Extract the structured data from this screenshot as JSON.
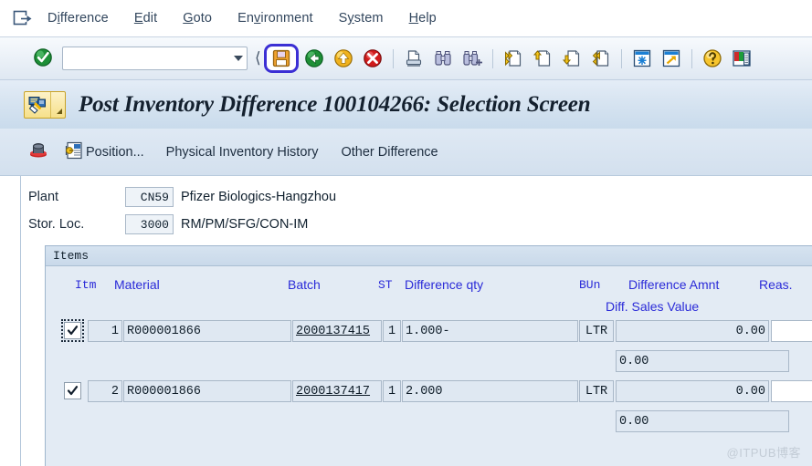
{
  "menubar": {
    "system_icon": "sap-system-menu-icon",
    "items": [
      {
        "label": "Difference",
        "accel_index": 1
      },
      {
        "label": "Edit",
        "accel_index": 0
      },
      {
        "label": "Goto",
        "accel_index": 0
      },
      {
        "label": "Environment",
        "accel_index": 2
      },
      {
        "label": "System",
        "accel_index": 1
      },
      {
        "label": "Help",
        "accel_index": 0
      }
    ]
  },
  "toolbar": {
    "ok_icon": "green-check-icon",
    "command_field": {
      "value": "",
      "placeholder": ""
    },
    "dropdown_icon": "chevron-down-icon",
    "buttons": [
      {
        "name": "save-button",
        "icon": "floppy-disk-icon",
        "highlighted": true
      },
      {
        "name": "back-button",
        "icon": "green-back-arrow-icon"
      },
      {
        "name": "exit-button",
        "icon": "yellow-up-arrow-icon"
      },
      {
        "name": "cancel-button",
        "icon": "red-x-circle-icon"
      },
      {
        "name": "print-button",
        "icon": "printer-icon"
      },
      {
        "name": "find-button",
        "icon": "binoculars-icon"
      },
      {
        "name": "find-next-button",
        "icon": "binoculars-plus-icon"
      },
      {
        "name": "first-page-button",
        "icon": "page-first-icon"
      },
      {
        "name": "previous-page-button",
        "icon": "page-up-icon"
      },
      {
        "name": "next-page-button",
        "icon": "page-down-icon"
      },
      {
        "name": "last-page-button",
        "icon": "page-last-icon"
      },
      {
        "name": "create-session-button",
        "icon": "new-session-icon"
      },
      {
        "name": "create-shortcut-button",
        "icon": "shortcut-arrow-icon"
      },
      {
        "name": "help-button",
        "icon": "question-mark-icon"
      },
      {
        "name": "customize-layout-button",
        "icon": "layout-menu-icon"
      }
    ]
  },
  "titlebar": {
    "icon": "transaction-title-icon",
    "dropdown_icon": "corner-triangle-icon",
    "title": "Post Inventory Difference 100104266: Selection Screen"
  },
  "apptoolbar": {
    "buttons": [
      {
        "name": "post-button",
        "label": "",
        "icon": "post-hat-icon"
      },
      {
        "name": "position-button",
        "label": "Position...",
        "icon": "position-icon"
      },
      {
        "name": "physical-inventory-history-button",
        "label": "Physical Inventory History",
        "icon": ""
      },
      {
        "name": "other-difference-button",
        "label": "Other Difference",
        "icon": ""
      }
    ]
  },
  "header": {
    "plant": {
      "label": "Plant",
      "value": "CN59",
      "description": "Pfizer Biologics-Hangzhou"
    },
    "storage_location": {
      "label": "Stor. Loc.",
      "value": "3000",
      "description": "RM/PM/SFG/CON-IM"
    }
  },
  "items": {
    "group_title": "Items",
    "columns": {
      "itm": "Itm",
      "material": "Material",
      "batch": "Batch",
      "st": "ST",
      "difference_qty": "Difference qty",
      "bun": "BUn",
      "difference_amnt": "Difference Amnt",
      "reason": "Reas.",
      "diff_sales_value": "Diff. Sales Value"
    },
    "rows": [
      {
        "selected": true,
        "focused": true,
        "itm": "1",
        "material": "R000001866",
        "batch": "2000137415",
        "st": "1",
        "difference_qty": "1.000-",
        "bun": "LTR",
        "difference_amnt": "0.00",
        "reason": "",
        "diff_sales_value": "0.00"
      },
      {
        "selected": true,
        "focused": false,
        "itm": "2",
        "material": "R000001866",
        "batch": "2000137417",
        "st": "1",
        "difference_qty": "2.000",
        "bun": "LTR",
        "difference_amnt": "0.00",
        "reason": "",
        "diff_sales_value": "0.00"
      }
    ]
  },
  "watermark": "@ITPUB博客",
  "colors": {
    "menu_text": "#33475e",
    "column_header": "#2b2bd8",
    "highlight_border": "#3b2fd4",
    "field_bg": "#dfe8f2",
    "panel_bg": "#e3ebf4"
  }
}
